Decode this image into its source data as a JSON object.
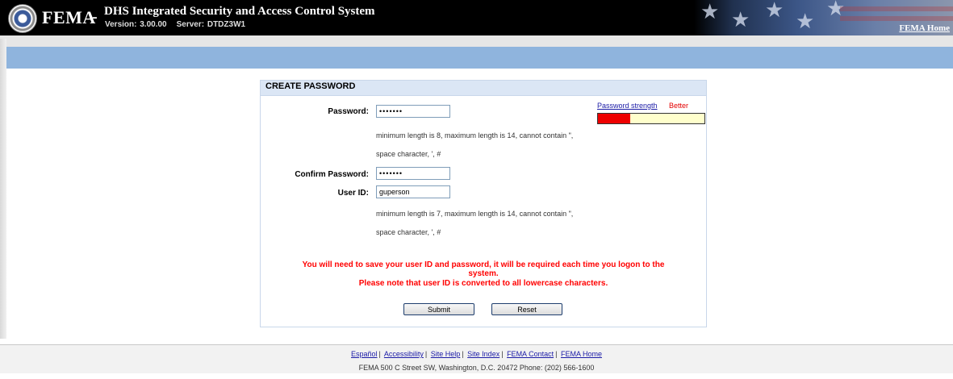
{
  "header": {
    "brand": "FEMA",
    "brand_dash": "-",
    "system_title": "DHS Integrated Security and Access Control System",
    "version": "Version: 3.00.00",
    "server": "Server: DTDZ3W1",
    "home_link": "FEMA Home"
  },
  "form": {
    "title": "CREATE PASSWORD",
    "password_label": "Password:",
    "password_value": "•••••••",
    "password_hint_1": "minimum length is 8, maximum length is 14, cannot contain \",",
    "password_hint_2": "space character, ', #",
    "strength_link": "Password strength",
    "strength_word": "Better",
    "strength_fraction": 0.3,
    "confirm_label": "Confirm Password:",
    "confirm_value": "•••••••",
    "userid_label": "User ID:",
    "userid_value": "guperson",
    "userid_hint_1": "minimum length is 7, maximum length is 14, cannot contain \",",
    "userid_hint_2": "space character, ', #",
    "notice_1": "You will need to save your user ID and password, it will be required each time you logon to the",
    "notice_2": "system.",
    "notice_3": "Please note that user ID is converted to all lowercase characters.",
    "submit_label": "Submit",
    "reset_label": "Reset"
  },
  "footer": {
    "links": [
      "Español",
      "Accessibility",
      "Site Help",
      "Site Index",
      "FEMA Contact",
      "FEMA Home"
    ],
    "address": "FEMA 500 C Street SW, Washington, D.C. 20472 Phone: (202) 566-1600"
  },
  "colors": {
    "header_bg": "#000000",
    "band_blue": "#8fb4dd",
    "notice_red": "#ff0000",
    "strength_red": "#ee0000",
    "strength_empty": "#ffffcc",
    "link_blue": "#1a1aa6"
  }
}
